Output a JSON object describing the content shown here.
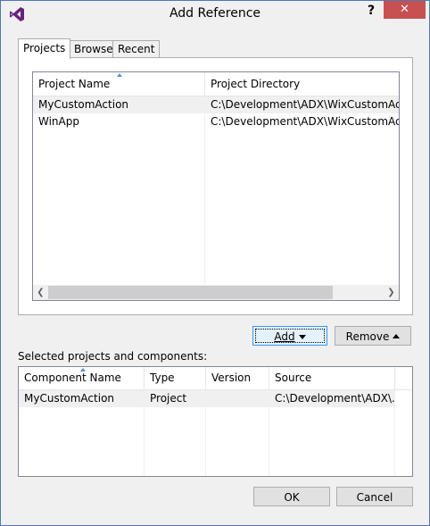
{
  "window": {
    "title": "Add Reference",
    "help_label": "?",
    "close_label": "✕",
    "accent": "#4e7ab5"
  },
  "tabs": [
    {
      "label": "Projects",
      "active": true
    },
    {
      "label": "Browse",
      "active": false
    },
    {
      "label": "Recent",
      "active": false
    }
  ],
  "projects_list": {
    "columns": [
      "Project Name",
      "Project Directory"
    ],
    "rows": [
      {
        "name": "MyCustomAction",
        "directory": "C:\\Development\\ADX\\WixCustomAction"
      },
      {
        "name": "WinApp",
        "directory": "C:\\Development\\ADX\\WixCustomAction"
      }
    ]
  },
  "add_button": {
    "label": "Add"
  },
  "remove_button": {
    "label": "Remove"
  },
  "selected_label": "Selected projects and components:",
  "selected_list": {
    "columns": [
      "Component Name",
      "Type",
      "Version",
      "Source"
    ],
    "rows": [
      {
        "component": "MyCustomAction",
        "type": "Project",
        "version": "",
        "source": "C:\\Development\\ADX\\..."
      }
    ]
  },
  "ok_button": {
    "label": "OK"
  },
  "cancel_button": {
    "label": "Cancel"
  }
}
